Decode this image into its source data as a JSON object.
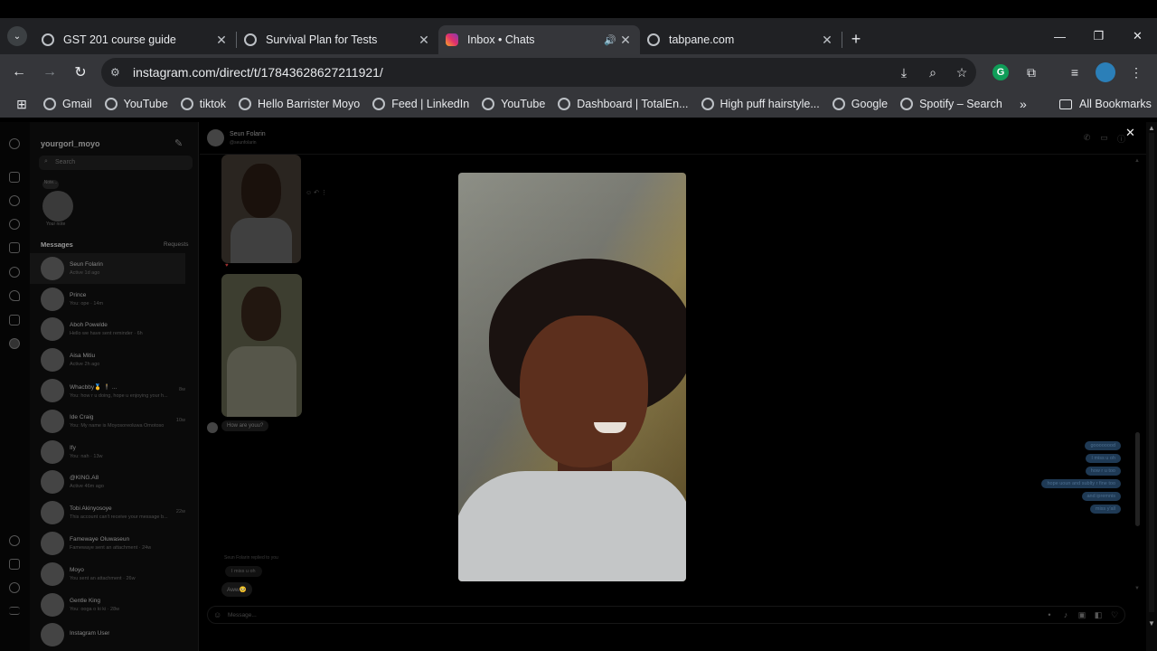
{
  "browser": {
    "tabs": [
      {
        "title": "GST 201 course guide",
        "favicon": "globe-icon"
      },
      {
        "title": "Survival Plan for Tests",
        "favicon": "openai-icon"
      },
      {
        "title": "Inbox • Chats",
        "favicon": "instagram-icon",
        "active": true,
        "audio": true
      },
      {
        "title": "tabpane.com",
        "favicon": "globe-icon"
      }
    ],
    "url": "instagram.com/direct/t/17843628627211921/",
    "bookmarks": [
      "Gmail",
      "YouTube",
      "tiktok",
      "Hello Barrister Moyo",
      "Feed | LinkedIn",
      "YouTube",
      "Dashboard | TotalEn...",
      "High puff hairstyle...",
      "Google",
      "Spotify – Search"
    ],
    "all_bookmarks": "All Bookmarks",
    "more_bookmarks": "»",
    "new_tab": "+",
    "window_controls": {
      "minimize": "—",
      "restore": "❐",
      "close": "✕"
    }
  },
  "instagram": {
    "username": "yourgorl_moyo",
    "search_placeholder": "Search",
    "note": {
      "bubble": "Note...",
      "caption": "Your note"
    },
    "messages_heading": "Messages",
    "requests_label": "Requests",
    "conversations": [
      {
        "name": "Seun Folarin",
        "preview": "Active 1d ago",
        "time": "",
        "selected": true
      },
      {
        "name": "Prince",
        "preview": "You: ope · 14m",
        "time": ""
      },
      {
        "name": "Aboh Powelde",
        "preview": "Hello we have sent reminder · 6h",
        "time": ""
      },
      {
        "name": "Aisa Mitiu",
        "preview": "Active 2h ago",
        "time": ""
      },
      {
        "name": "Whacbby🥇 🕴 ...",
        "preview": "You: how r u doing, hope u enjoying your h...",
        "time": "8w"
      },
      {
        "name": "Ide Craig",
        "preview": "You: My name is Moyosoreoluwa Omotoso",
        "time": "10w"
      },
      {
        "name": "Ify",
        "preview": "You: nah · 13w",
        "time": ""
      },
      {
        "name": "@KING.A8",
        "preview": "Active 46m ago",
        "time": ""
      },
      {
        "name": "Tobi Akinyosoye",
        "preview": "This account can't receive your message b...",
        "time": "22w"
      },
      {
        "name": "Famewaye Oluwaseun",
        "preview": "Famewaye sent an attachment · 24w",
        "time": ""
      },
      {
        "name": "Moyo",
        "preview": "You sent an attachment · 26w",
        "time": ""
      },
      {
        "name": "Gentle King",
        "preview": "You: ooga o ki ki · 28w",
        "time": ""
      },
      {
        "name": "Instagram User",
        "preview": "",
        "time": ""
      }
    ],
    "chat": {
      "contact_name": "Seun Folarin",
      "contact_handle": "@seunfolarin",
      "received_text": "How are youu?",
      "reply_caption": "Seun Folarin replied to you",
      "reply_quote": "I miss u oh",
      "reply_text": "Aww🥺",
      "sent_messages": [
        "goooooood",
        "I miss u oh",
        "how r u too",
        "hope uoun and sublty r fine too",
        "and ipremnis",
        "miss y'all"
      ],
      "composer_placeholder": "Message..."
    }
  }
}
